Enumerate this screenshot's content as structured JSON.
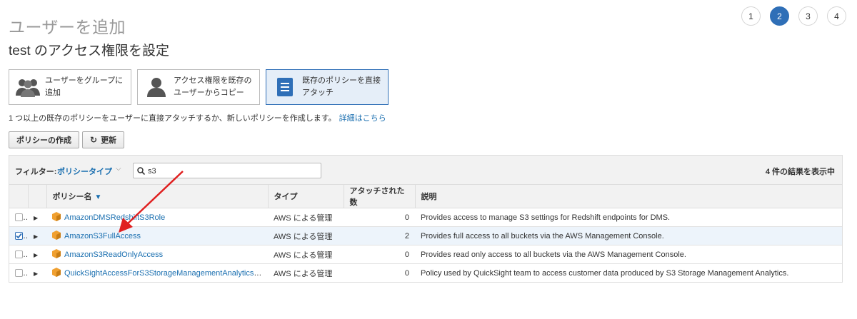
{
  "page": {
    "title": "ユーザーを追加"
  },
  "steps": [
    "1",
    "2",
    "3",
    "4"
  ],
  "active_step": "2",
  "section_title": "test のアクセス権限を設定",
  "options": [
    {
      "label": "ユーザーをグループに追加",
      "icon": "group-icon"
    },
    {
      "label": "アクセス権限を既存のユーザーからコピー",
      "icon": "user-icon"
    },
    {
      "label": "既存のポリシーを直接アタッチ",
      "icon": "document-icon",
      "selected": true
    }
  ],
  "help": {
    "text": "1 つ以上の既存のポリシーをユーザーに直接アタッチするか、新しいポリシーを作成します。",
    "link": "詳細はこちら"
  },
  "buttons": {
    "create_policy": "ポリシーの作成",
    "refresh": "更新"
  },
  "filter": {
    "label": "フィルター:",
    "type": "ポリシータイプ",
    "search_value": "s3",
    "results": "4 件の結果を表示中"
  },
  "table": {
    "headers": {
      "name": "ポリシー名",
      "type": "タイプ",
      "attached": "アタッチされた数",
      "description": "説明"
    },
    "rows": [
      {
        "name": "AmazonDMSRedshiftS3Role",
        "type": "AWS による管理",
        "attached": "0",
        "description": "Provides access to manage S3 settings for Redshift endpoints for DMS.",
        "checked": false
      },
      {
        "name": "AmazonS3FullAccess",
        "type": "AWS による管理",
        "attached": "2",
        "description": "Provides full access to all buckets via the AWS Management Console.",
        "checked": true
      },
      {
        "name": "AmazonS3ReadOnlyAccess",
        "type": "AWS による管理",
        "attached": "0",
        "description": "Provides read only access to all buckets via the AWS Management Console.",
        "checked": false
      },
      {
        "name": "QuickSightAccessForS3StorageManagementAnalyticsR...",
        "type": "AWS による管理",
        "attached": "0",
        "description": "Policy used by QuickSight team to access customer data produced by S3 Storage Management Analytics.",
        "checked": false
      }
    ]
  },
  "colors": {
    "accent": "#2f6fb7",
    "link": "#1a6fb0",
    "annotation_arrow": "#e02020",
    "policy_icon": "#f0a030"
  }
}
